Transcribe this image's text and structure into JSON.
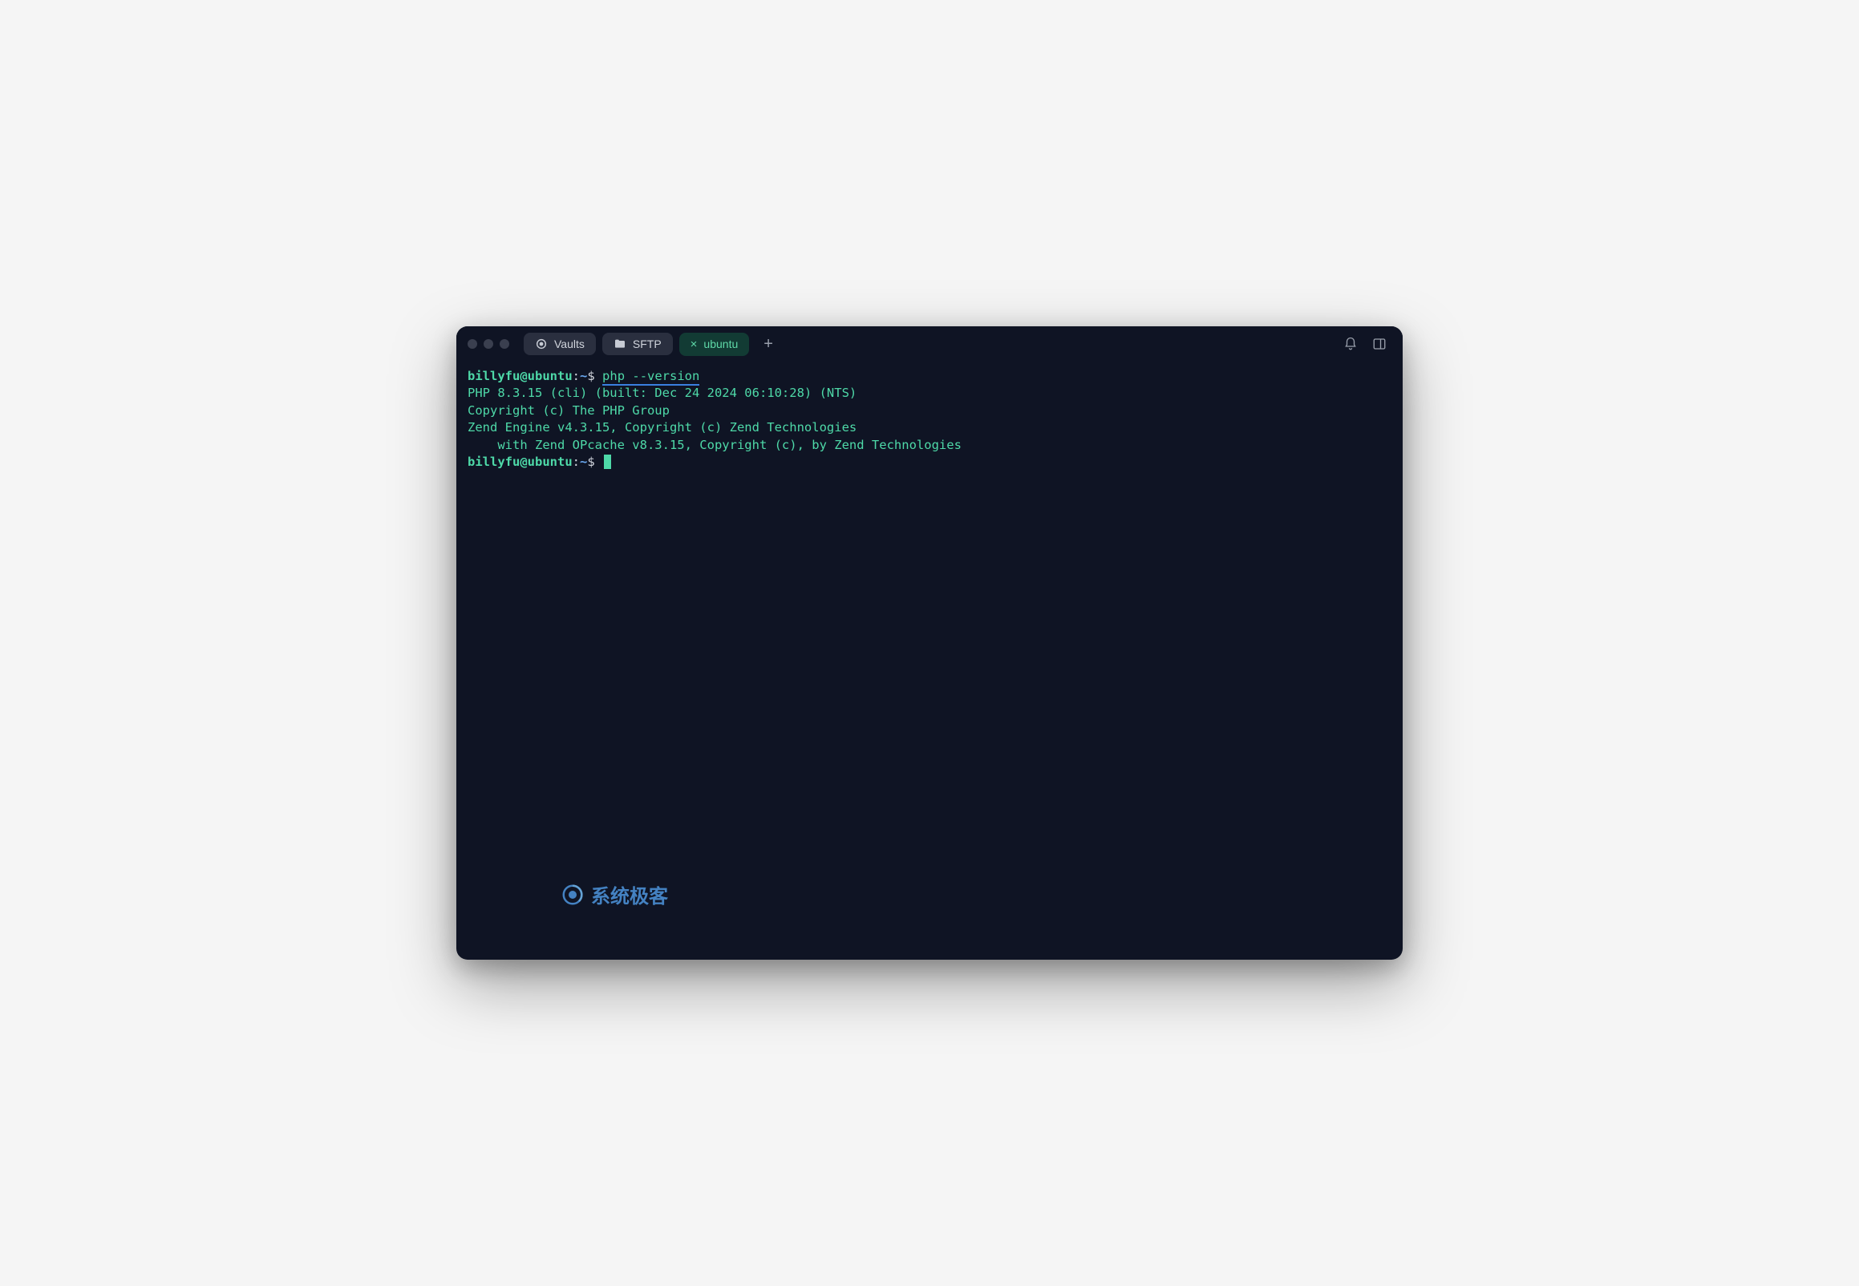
{
  "tabs": {
    "vaults": "Vaults",
    "sftp": "SFTP",
    "ubuntu": "ubuntu"
  },
  "terminal": {
    "prompt_user_host": "billyfu@ubuntu",
    "prompt_colon": ":",
    "prompt_path": "~",
    "prompt_dollar": "$",
    "command": "php --version",
    "out1": "PHP 8.3.15 (cli) (built: Dec 24 2024 06:10:28) (NTS)",
    "out2": "Copyright (c) The PHP Group",
    "out3": "Zend Engine v4.3.15, Copyright (c) Zend Technologies",
    "out4": "    with Zend OPcache v8.3.15, Copyright (c), by Zend Technologies"
  },
  "watermark": {
    "text": "系统极客"
  }
}
